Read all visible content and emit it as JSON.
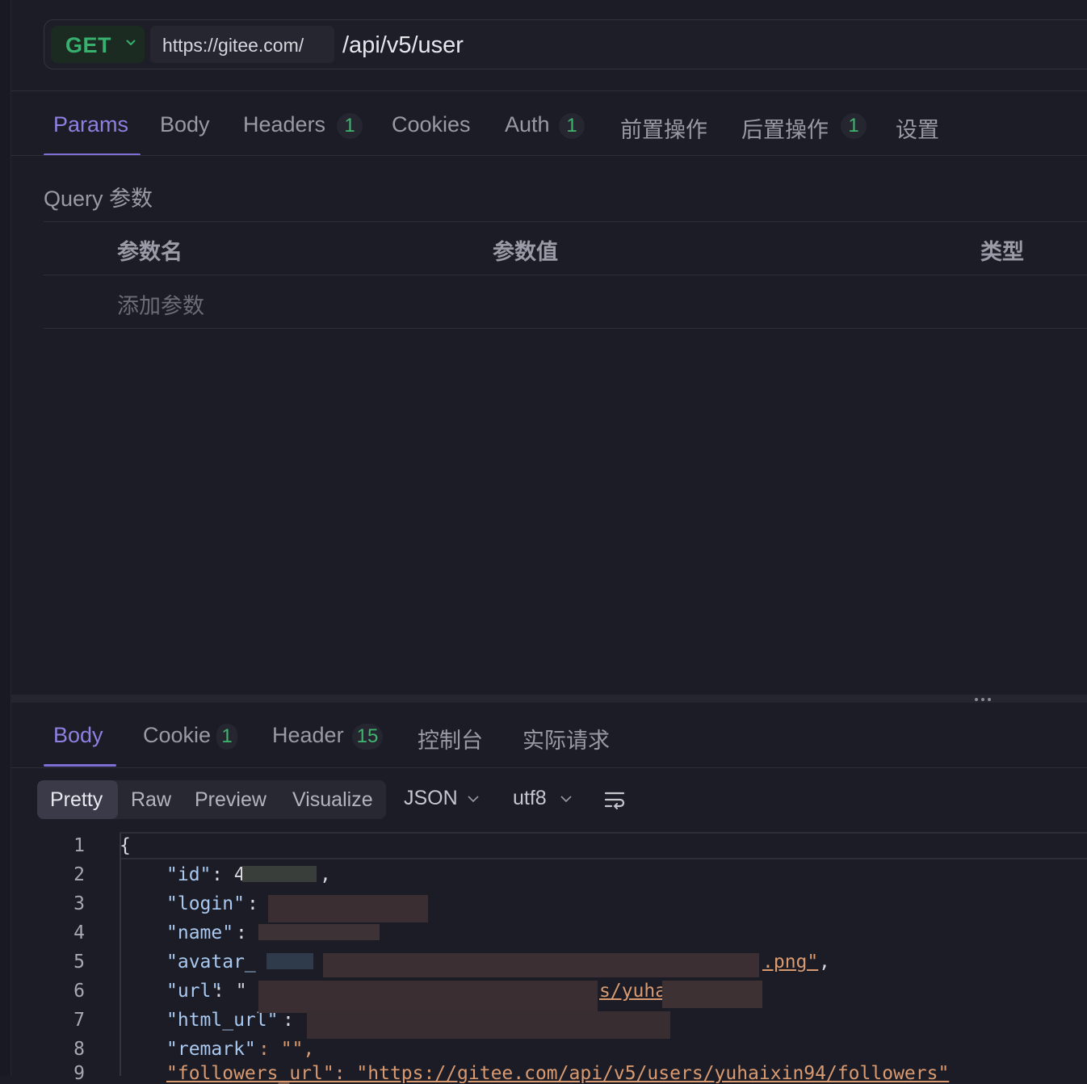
{
  "request": {
    "method": "GET",
    "base_url": "https://gitee.com/",
    "path": "/api/v5/user"
  },
  "request_tabs": [
    {
      "label": "Params",
      "badge": ""
    },
    {
      "label": "Body",
      "badge": ""
    },
    {
      "label": "Headers",
      "badge": "1"
    },
    {
      "label": "Cookies",
      "badge": ""
    },
    {
      "label": "Auth",
      "badge": "1"
    },
    {
      "label": "前置操作",
      "badge": ""
    },
    {
      "label": "后置操作",
      "badge": "1"
    },
    {
      "label": "设置",
      "badge": ""
    }
  ],
  "params": {
    "section_title": "Query 参数",
    "columns": [
      "参数名",
      "参数值",
      "类型"
    ],
    "add_placeholder": "添加参数"
  },
  "response_tabs": [
    {
      "label": "Body",
      "badge": ""
    },
    {
      "label": "Cookie",
      "badge": "1"
    },
    {
      "label": "Header",
      "badge": "15"
    },
    {
      "label": "控制台",
      "badge": ""
    },
    {
      "label": "实际请求",
      "badge": ""
    }
  ],
  "format": {
    "views": [
      "Pretty",
      "Raw",
      "Preview",
      "Visualize"
    ],
    "active_view": "Pretty",
    "language": "JSON",
    "encoding": "utf8"
  },
  "code": {
    "line_numbers": [
      "1",
      "2",
      "3",
      "4",
      "5",
      "6",
      "7",
      "8",
      "9"
    ],
    "open_brace": "{",
    "id_key": "\"id\"",
    "id_visible": ": 4",
    "id_end": ",",
    "login_key": "\"login\"",
    "login_colon": ":",
    "name_key": "\"name\"",
    "name_colon": ":",
    "avatar_key": "\"avatar_",
    "avatar_tail": ".png\"",
    "avatar_end": ",",
    "url_key": "\"url\"",
    "url_colon": ": \"",
    "url_tail": "s/yuha",
    "html_url_key": "\"html_url\"",
    "html_url_colon": ":",
    "remark_key": "\"remark\"",
    "remark_value": ": \"\",",
    "followers_line": "\"followers_url\": \"https://gitee.com/api/v5/users/yuhaixin94/followers\""
  },
  "colors": {
    "accent": "#7d6fd6",
    "method_green": "#37b16d",
    "badge_green": "#3fb56e",
    "background": "#1c1c26"
  }
}
